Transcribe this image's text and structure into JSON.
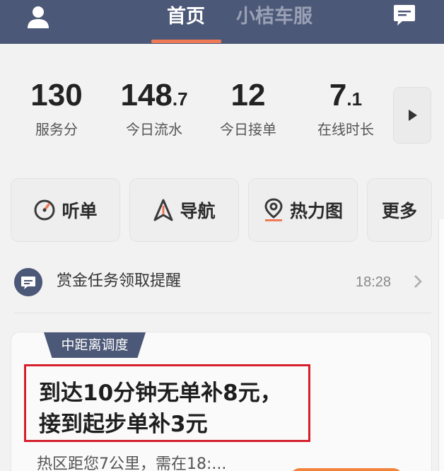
{
  "colors": {
    "header_bg": "#4c5877",
    "accent": "#ef7a55",
    "highlight_border": "#d5202b"
  },
  "header": {
    "tabs": [
      {
        "label": "首页",
        "active": true
      },
      {
        "label": "小桔车服",
        "active": false
      }
    ],
    "left_icon": "user-icon",
    "right_icon": "message-icon"
  },
  "stats": [
    {
      "int": "130",
      "dec": "",
      "label": "服务分"
    },
    {
      "int": "148",
      "dec": ".7",
      "label": "今日流水"
    },
    {
      "int": "12",
      "dec": "",
      "label": "今日接单"
    },
    {
      "int": "7",
      "dec": ".1",
      "label": "在线时长"
    }
  ],
  "actions": [
    {
      "label": "听单",
      "icon": "gauge-icon"
    },
    {
      "label": "导航",
      "icon": "navigation-icon"
    },
    {
      "label": "热力图",
      "icon": "location-pin-icon"
    },
    {
      "label": "更多",
      "icon": ""
    }
  ],
  "notice": {
    "text": "赏金任务领取提醒",
    "time": "18:28"
  },
  "card": {
    "tag": "中距离调度",
    "headline_line1": "到达10分钟无单补8元，",
    "headline_line2": "接到起步单补3元",
    "subtext": "热区距您7公里，需在18:..."
  }
}
